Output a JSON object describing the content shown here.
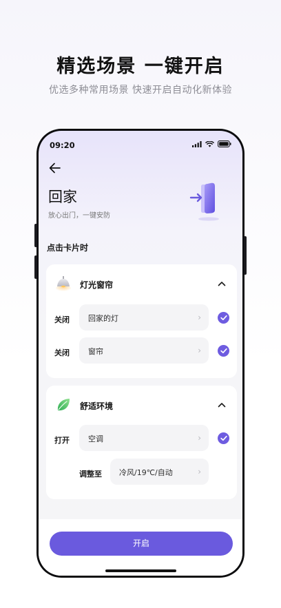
{
  "promo": {
    "title": "精选场景  一键开启",
    "subtitle": "优选多种常用场景 快速开启自动化新体验"
  },
  "status_bar": {
    "time": "09:20"
  },
  "scene": {
    "title": "回家",
    "subtitle": "放心出门，一键安防"
  },
  "section_label": "点击卡片时",
  "groups": [
    {
      "title": "灯光窗帘",
      "icon": "lamp-icon",
      "rows": [
        {
          "action": "关闭",
          "target": "回家的灯",
          "checked": true
        },
        {
          "action": "关闭",
          "target": "窗帘",
          "checked": true
        }
      ]
    },
    {
      "title": "舒适环境",
      "icon": "leaf-icon",
      "rows": [
        {
          "action": "打开",
          "target": "空调",
          "checked": true
        },
        {
          "action": "调整至",
          "target": "冷风/19℃/自动"
        }
      ]
    }
  ],
  "cta": {
    "label": "开启"
  },
  "colors": {
    "accent": "#6a5ade",
    "check": "#6e5ce0"
  }
}
